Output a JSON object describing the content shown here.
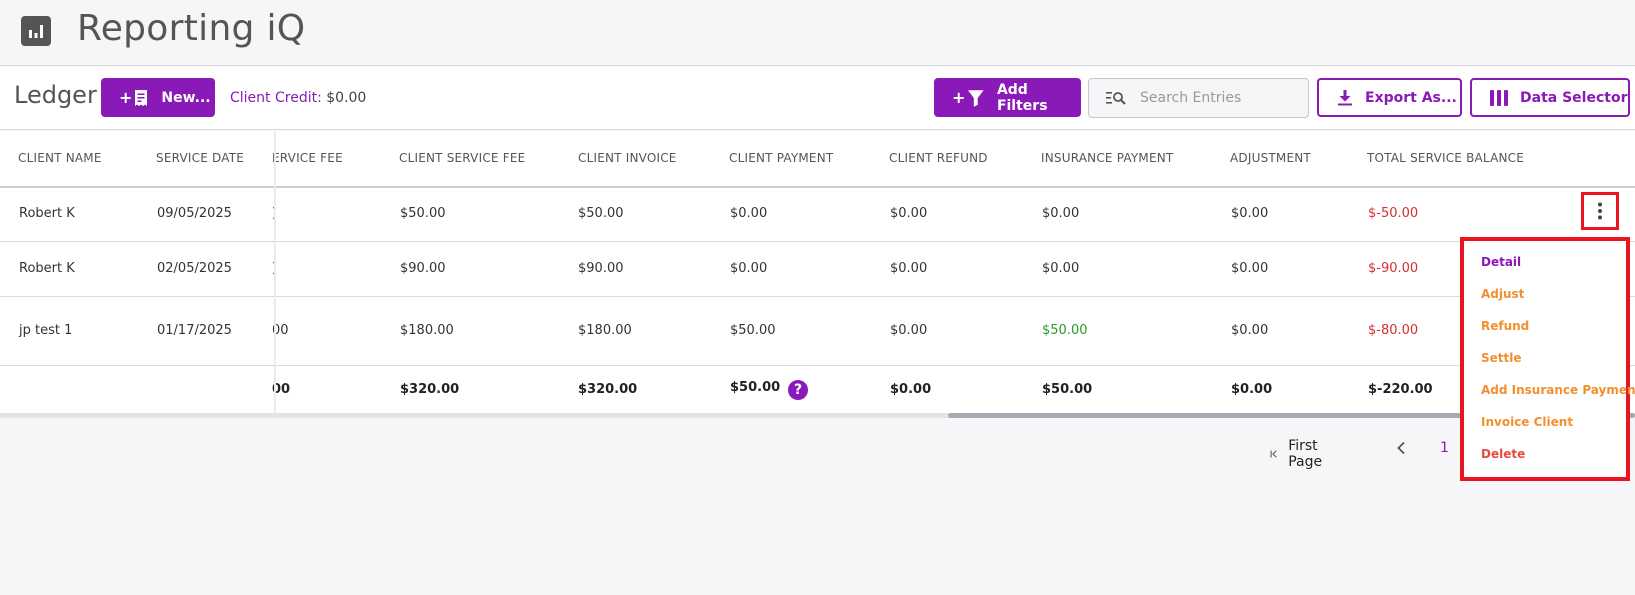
{
  "app": {
    "title": "Reporting iQ",
    "logo_icon": "bar-chart-icon"
  },
  "toolbar": {
    "ledger_title": "Ledger",
    "new_plus": "+",
    "new_label": "New...",
    "credit_label": "Client Credit:",
    "credit_value": " $0.00",
    "filter_plus": "+",
    "add_filters_label": "Add Filters",
    "search_placeholder": "Search Entries",
    "export_label": "Export As...",
    "data_selector_label": "Data Selector"
  },
  "table": {
    "headers": [
      "CLIENT NAME",
      "SERVICE DATE",
      "ERVICE FEE",
      "CLIENT SERVICE FEE",
      "CLIENT INVOICE",
      "CLIENT PAYMENT",
      "CLIENT REFUND",
      "INSURANCE PAYMENT",
      "ADJUSTMENT",
      "TOTAL SERVICE BALANCE"
    ],
    "rows": [
      [
        "Robert K",
        "09/05/2025",
        ")",
        "$50.00",
        "$50.00",
        "$0.00",
        "$0.00",
        "$0.00",
        "$0.00",
        "$-50.00"
      ],
      [
        "Robert K",
        "02/05/2025",
        ")",
        "$90.00",
        "$90.00",
        "$0.00",
        "$0.00",
        "$0.00",
        "$0.00",
        "$-90.00"
      ],
      [
        "jp test 1",
        "01/17/2025",
        "00",
        "$180.00",
        "$180.00",
        "$50.00",
        "$0.00",
        "$50.00",
        "$0.00",
        "$-80.00"
      ]
    ],
    "totals": [
      "",
      "",
      "00",
      "$320.00",
      "$320.00",
      "$50.00",
      "$0.00",
      "$50.00",
      "$0.00",
      "$-220.00"
    ],
    "help_glyph": "?",
    "colors": {
      "negative": "#d62e2e",
      "positive": "#2a9a2a",
      "accent": "#8a1ab8"
    }
  },
  "pagination": {
    "first_label": "First Page",
    "current_page": "1"
  },
  "row_menu": {
    "items": [
      {
        "label": "Detail",
        "color": "purple"
      },
      {
        "label": "Adjust",
        "color": "orange"
      },
      {
        "label": "Refund",
        "color": "orange"
      },
      {
        "label": "Settle",
        "color": "orange"
      },
      {
        "label": "Add Insurance Payment",
        "color": "orange"
      },
      {
        "label": "Invoice Client",
        "color": "orange"
      },
      {
        "label": "Delete",
        "color": "red"
      }
    ]
  }
}
